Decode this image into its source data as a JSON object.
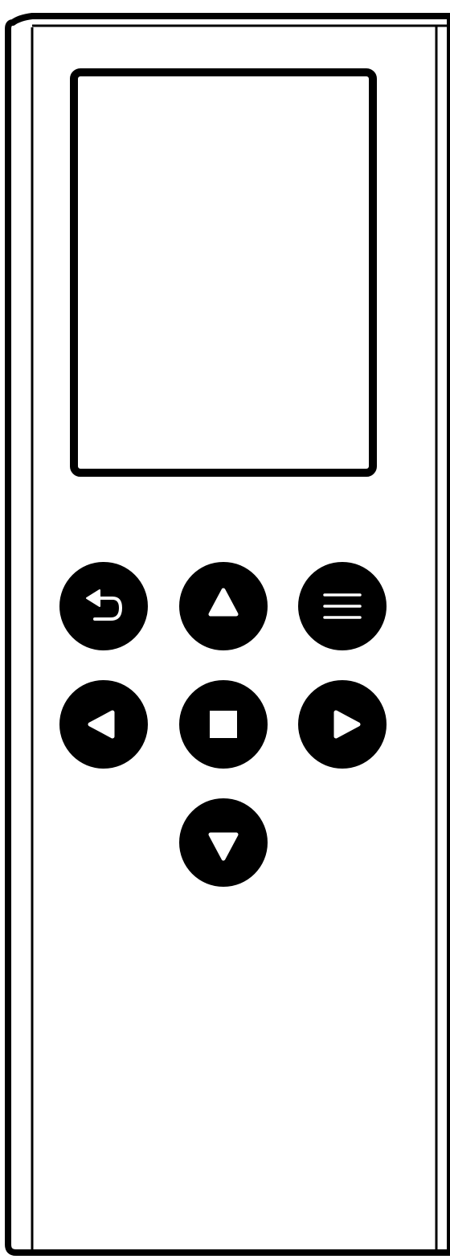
{
  "device": {
    "body_color": "#ffffff",
    "outline_color": "#000000",
    "screen_color": "#ffffff"
  },
  "buttons": [
    {
      "name": "back-button",
      "icon": "back-arrow-icon"
    },
    {
      "name": "up-button",
      "icon": "triangle-up-icon"
    },
    {
      "name": "menu-button",
      "icon": "hamburger-menu-icon"
    },
    {
      "name": "left-button",
      "icon": "triangle-left-icon"
    },
    {
      "name": "ok-button",
      "icon": "square-stop-icon"
    },
    {
      "name": "right-button",
      "icon": "triangle-right-icon"
    },
    {
      "name": "down-button",
      "icon": "triangle-down-icon"
    }
  ],
  "colors": {
    "button_fill": "#000000",
    "icon_fill": "#ffffff"
  }
}
